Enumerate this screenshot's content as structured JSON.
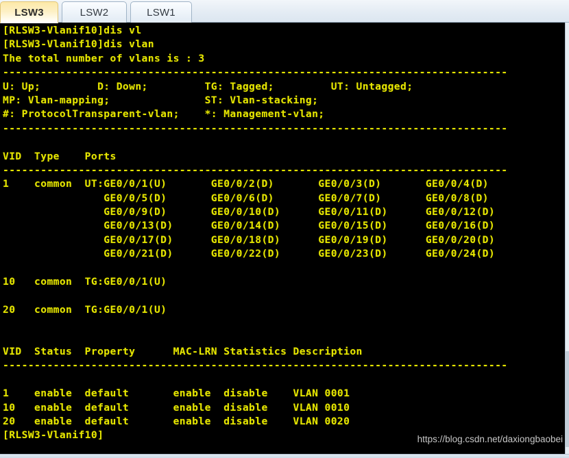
{
  "window": {
    "title": "LSW3",
    "accent_active_tab": "#fde9a8",
    "terminal_bg": "#000000",
    "terminal_fg": "#e5e500"
  },
  "tabs": [
    {
      "label": "LSW3",
      "active": true
    },
    {
      "label": "LSW2",
      "active": false
    },
    {
      "label": "LSW1",
      "active": false
    }
  ],
  "terminal": {
    "prompt": "[RLSW3-Vlanif10]",
    "lines": [
      "[RLSW3-Vlanif10]dis vl",
      "[RLSW3-Vlanif10]dis vlan",
      "The total number of vlans is : 3",
      "--------------------------------------------------------------------------------",
      "U: Up;         D: Down;         TG: Tagged;         UT: Untagged;",
      "MP: Vlan-mapping;               ST: Vlan-stacking;",
      "#: ProtocolTransparent-vlan;    *: Management-vlan;",
      "--------------------------------------------------------------------------------",
      "",
      "VID  Type    Ports",
      "--------------------------------------------------------------------------------",
      "1    common  UT:GE0/0/1(U)       GE0/0/2(D)       GE0/0/3(D)       GE0/0/4(D)",
      "                GE0/0/5(D)       GE0/0/6(D)       GE0/0/7(D)       GE0/0/8(D)",
      "                GE0/0/9(D)       GE0/0/10(D)      GE0/0/11(D)      GE0/0/12(D)",
      "                GE0/0/13(D)      GE0/0/14(D)      GE0/0/15(D)      GE0/0/16(D)",
      "                GE0/0/17(D)      GE0/0/18(D)      GE0/0/19(D)      GE0/0/20(D)",
      "                GE0/0/21(D)      GE0/0/22(D)      GE0/0/23(D)      GE0/0/24(D)",
      "",
      "10   common  TG:GE0/0/1(U)",
      "",
      "20   common  TG:GE0/0/1(U)",
      "",
      "",
      "VID  Status  Property      MAC-LRN Statistics Description",
      "--------------------------------------------------------------------------------",
      "",
      "1    enable  default       enable  disable    VLAN 0001",
      "10   enable  default       enable  disable    VLAN 0010",
      "20   enable  default       enable  disable    VLAN 0020",
      "[RLSW3-Vlanif10]"
    ]
  },
  "vlan_brief": {
    "headers": [
      "VID",
      "Type",
      "Ports"
    ],
    "rows": [
      {
        "vid": "1",
        "type": "common",
        "ports": [
          "UT:GE0/0/1(U)",
          "GE0/0/2(D)",
          "GE0/0/3(D)",
          "GE0/0/4(D)",
          "GE0/0/5(D)",
          "GE0/0/6(D)",
          "GE0/0/7(D)",
          "GE0/0/8(D)",
          "GE0/0/9(D)",
          "GE0/0/10(D)",
          "GE0/0/11(D)",
          "GE0/0/12(D)",
          "GE0/0/13(D)",
          "GE0/0/14(D)",
          "GE0/0/15(D)",
          "GE0/0/16(D)",
          "GE0/0/17(D)",
          "GE0/0/18(D)",
          "GE0/0/19(D)",
          "GE0/0/20(D)",
          "GE0/0/21(D)",
          "GE0/0/22(D)",
          "GE0/0/23(D)",
          "GE0/0/24(D)"
        ]
      },
      {
        "vid": "10",
        "type": "common",
        "ports": [
          "TG:GE0/0/1(U)"
        ]
      },
      {
        "vid": "20",
        "type": "common",
        "ports": [
          "TG:GE0/0/1(U)"
        ]
      }
    ]
  },
  "vlan_detail": {
    "headers": [
      "VID",
      "Status",
      "Property",
      "MAC-LRN",
      "Statistics",
      "Description"
    ],
    "rows": [
      [
        "1",
        "enable",
        "default",
        "enable",
        "disable",
        "VLAN 0001"
      ],
      [
        "10",
        "enable",
        "default",
        "enable",
        "disable",
        "VLAN 0010"
      ],
      [
        "20",
        "enable",
        "default",
        "enable",
        "disable",
        "VLAN 0020"
      ]
    ]
  },
  "legend": {
    "items": [
      "U: Up;",
      "D: Down;",
      "TG: Tagged;",
      "UT: Untagged;",
      "MP: Vlan-mapping;",
      "ST: Vlan-stacking;",
      "#: ProtocolTransparent-vlan;",
      "*: Management-vlan;"
    ]
  },
  "summary": {
    "total_vlans_text": "The total number of vlans is : 3",
    "total_vlans": 3
  },
  "commands": [
    "dis vl",
    "dis vlan"
  ],
  "watermark": {
    "text": "https://blog.csdn.net/daxiongbaobei"
  }
}
